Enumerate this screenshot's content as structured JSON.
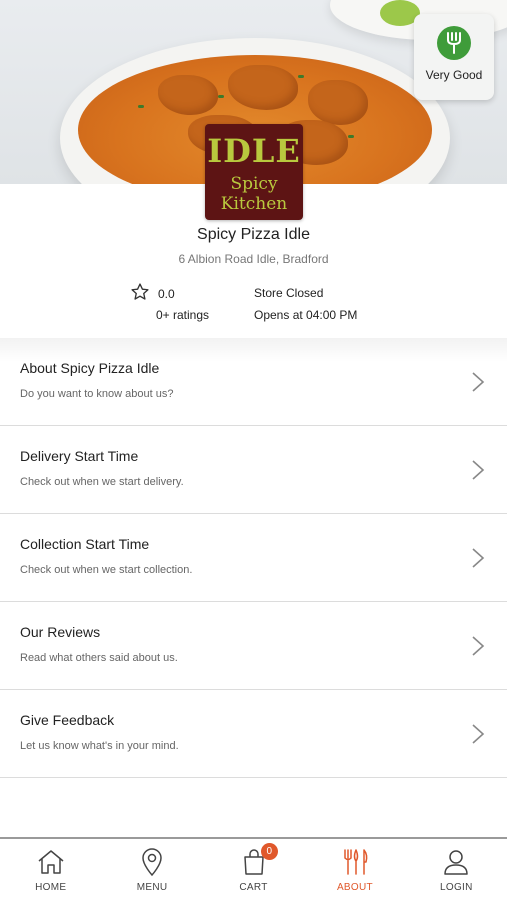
{
  "hero": {
    "rating_badge": {
      "label": "Very Good",
      "icon": "fork-icon",
      "color": "#3f9c3a"
    },
    "logo": {
      "line1": "IDLE",
      "line2": "Spicy Kitchen",
      "bg_color": "#5d1414",
      "text_color": "#b9c93e"
    }
  },
  "store": {
    "name": "Spicy Pizza Idle",
    "address": "6 Albion Road Idle, Bradford",
    "rating_value": "0.0",
    "rating_count": "0+ ratings",
    "status": "Store Closed",
    "opens_at": "Opens at 04:00 PM"
  },
  "menu": {
    "items": [
      {
        "title": "About Spicy Pizza Idle",
        "subtitle": "Do you want to know about us?"
      },
      {
        "title": "Delivery Start Time",
        "subtitle": "Check out when we start delivery."
      },
      {
        "title": "Collection Start Time",
        "subtitle": "Check out when we start collection."
      },
      {
        "title": "Our Reviews",
        "subtitle": "Read what others said about us."
      },
      {
        "title": "Give Feedback",
        "subtitle": "Let us know what's in your mind."
      }
    ]
  },
  "nav": {
    "accent": "#e0582b",
    "cart_count": "0",
    "items": [
      {
        "label": "HOME",
        "icon": "home-icon"
      },
      {
        "label": "MENU",
        "icon": "location-pin-icon"
      },
      {
        "label": "CART",
        "icon": "cart-bag-icon"
      },
      {
        "label": "ABOUT",
        "icon": "cutlery-icon",
        "active": true
      },
      {
        "label": "LOGIN",
        "icon": "user-icon"
      }
    ]
  }
}
